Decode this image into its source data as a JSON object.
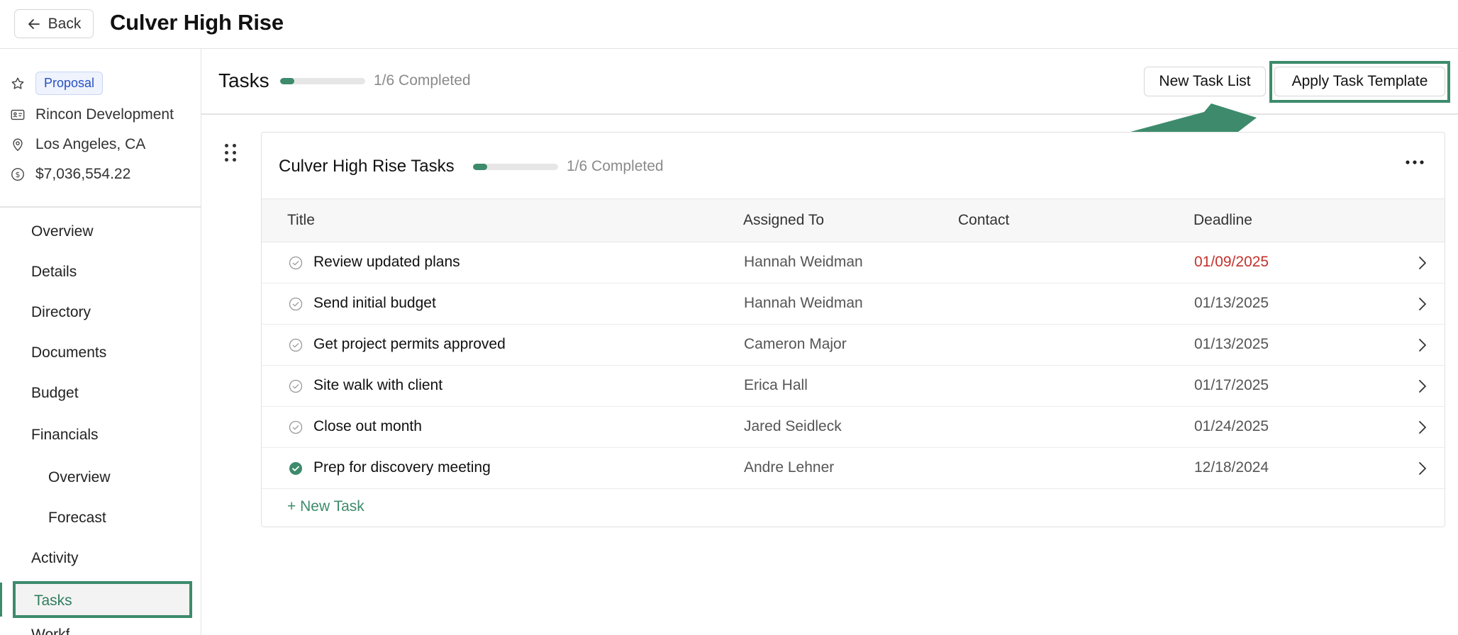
{
  "header": {
    "back_label": "Back",
    "project_title": "Culver High Rise"
  },
  "sidebar": {
    "status_badge": "Proposal",
    "client": "Rincon Development",
    "location": "Los Angeles, CA",
    "amount": "$7,036,554.22",
    "nav": [
      {
        "label": "Overview"
      },
      {
        "label": "Details"
      },
      {
        "label": "Directory"
      },
      {
        "label": "Documents"
      },
      {
        "label": "Budget"
      },
      {
        "label": "Financials"
      },
      {
        "label": "Overview"
      },
      {
        "label": "Forecast"
      },
      {
        "label": "Activity"
      },
      {
        "label": "Tasks"
      },
      {
        "label": "Workf"
      }
    ]
  },
  "main": {
    "heading": "Tasks",
    "completed_text": "1/6 Completed",
    "progress_fraction": 0.1667,
    "new_task_list_label": "New Task List",
    "apply_template_label": "Apply Task Template",
    "task_list": {
      "title": "Culver High Rise Tasks",
      "completed_text": "1/6 Completed",
      "progress_fraction": 0.1667,
      "columns": {
        "title": "Title",
        "assigned": "Assigned To",
        "contact": "Contact",
        "deadline": "Deadline"
      },
      "rows": [
        {
          "title": "Review updated plans",
          "assigned": "Hannah Weidman",
          "contact": "",
          "deadline": "01/09/2025",
          "done": false,
          "overdue": true
        },
        {
          "title": "Send initial budget",
          "assigned": "Hannah Weidman",
          "contact": "",
          "deadline": "01/13/2025",
          "done": false,
          "overdue": false
        },
        {
          "title": "Get project permits approved",
          "assigned": "Cameron Major",
          "contact": "",
          "deadline": "01/13/2025",
          "done": false,
          "overdue": false
        },
        {
          "title": "Site walk with client",
          "assigned": "Erica Hall",
          "contact": "",
          "deadline": "01/17/2025",
          "done": false,
          "overdue": false
        },
        {
          "title": "Close out month",
          "assigned": "Jared Seidleck",
          "contact": "",
          "deadline": "01/24/2025",
          "done": false,
          "overdue": false
        },
        {
          "title": "Prep for discovery meeting",
          "assigned": "Andre Lehner",
          "contact": "",
          "deadline": "12/18/2024",
          "done": true,
          "overdue": false
        }
      ],
      "new_task_label": "+ New Task"
    }
  },
  "colors": {
    "accent": "#3d8b6c",
    "overdue": "#c4322b",
    "badge_text": "#2950c2"
  },
  "icons": {
    "back": "arrow-left-icon",
    "favorite": "star-icon",
    "client": "id-card-icon",
    "location": "map-pin-icon",
    "amount": "dollar-circle-icon",
    "drag": "drag-handle-icon",
    "menu": "more-horizontal-icon",
    "row_status": "check-circle-icon",
    "row_open": "chevron-right-icon"
  }
}
